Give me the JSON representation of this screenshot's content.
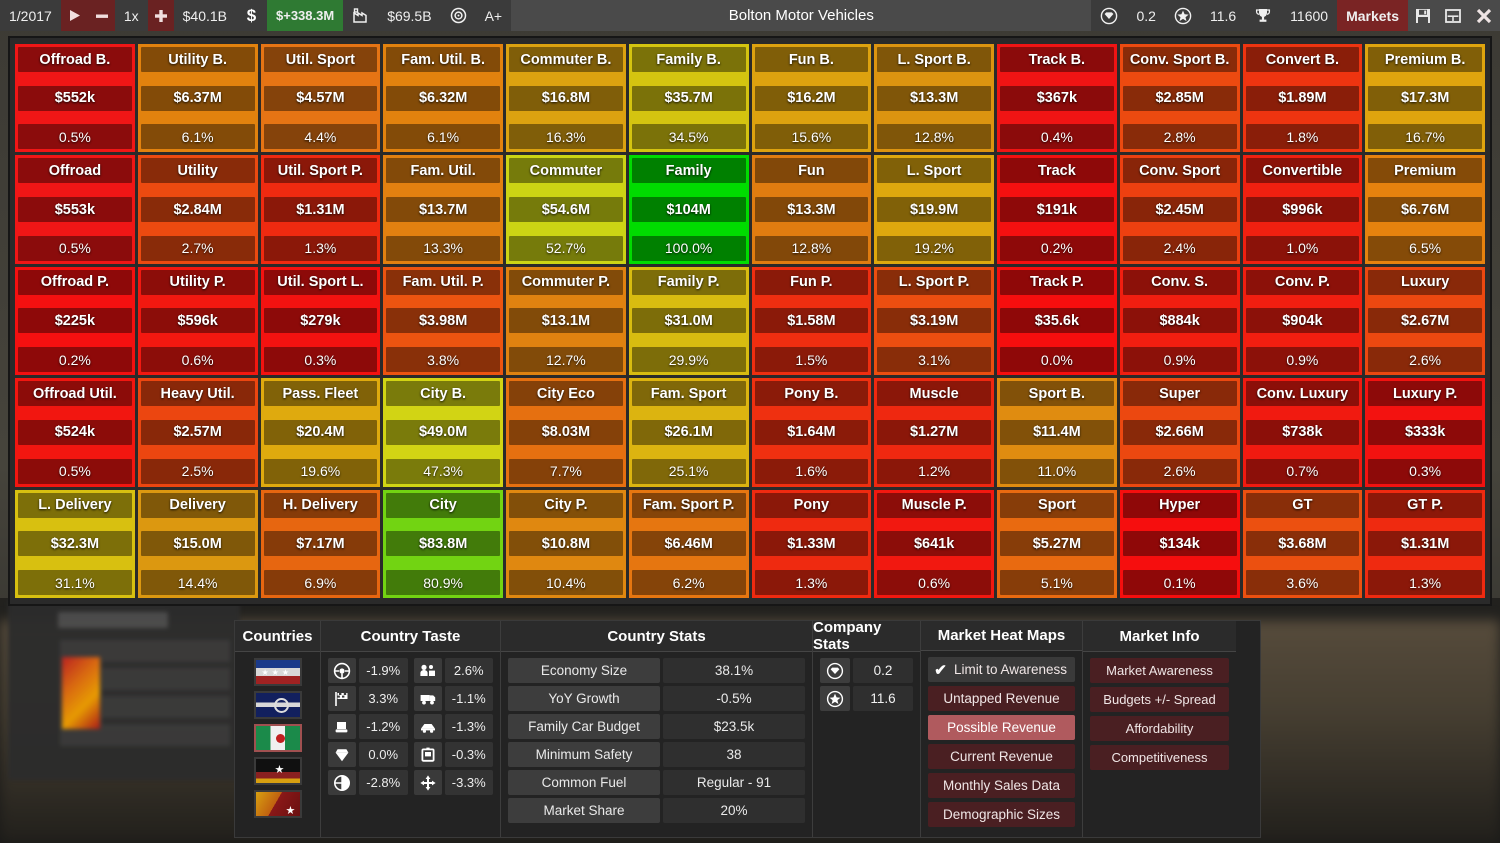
{
  "topbar": {
    "date": "1/2017",
    "play_icon": "play-icon",
    "minus_icon": "minus-icon",
    "speed": "1x",
    "plus_icon": "plus-icon",
    "cash": "$40.1B",
    "dollar_icon": "dollar-icon",
    "profit": "$+338.3M",
    "factory_icon": "factory-icon",
    "assets": "$69.5B",
    "target_icon": "target-icon",
    "rating": "A+",
    "title": "Bolton Motor Vehicles",
    "gem_icon": "gem-icon",
    "gem_value": "0.2",
    "star_icon": "star-icon",
    "star_value": "11.6",
    "trophy_icon": "trophy-icon",
    "trophy_value": "11600",
    "markets_label": "Markets",
    "save_icon": "save-icon",
    "window-icon": "window-icon",
    "close_icon": "close-icon"
  },
  "heatmap": {
    "colors": {
      "lowest": "#e01010",
      "low": "#e64a10",
      "mid": "#e07a10",
      "warm": "#d8a410",
      "yellow": "#d8d010",
      "lime": "#8cd014",
      "green": "#22c422",
      "brightgreen": "#00d800"
    },
    "cells": [
      {
        "name": "Offroad B.",
        "value": "$552k",
        "pct": "0.5%",
        "color": "#f01616"
      },
      {
        "name": "Utility B.",
        "value": "$6.37M",
        "pct": "6.1%",
        "color": "#e2820e"
      },
      {
        "name": "Util. Sport",
        "value": "$4.57M",
        "pct": "4.4%",
        "color": "#e67414"
      },
      {
        "name": "Fam. Util. B.",
        "value": "$6.32M",
        "pct": "6.1%",
        "color": "#e2820e"
      },
      {
        "name": "Commuter B.",
        "value": "$16.8M",
        "pct": "16.3%",
        "color": "#dca210"
      },
      {
        "name": "Family B.",
        "value": "$35.7M",
        "pct": "34.5%",
        "color": "#d4c410"
      },
      {
        "name": "Fun B.",
        "value": "$16.2M",
        "pct": "15.6%",
        "color": "#dda20f"
      },
      {
        "name": "L. Sport B.",
        "value": "$13.3M",
        "pct": "12.8%",
        "color": "#dc9410"
      },
      {
        "name": "Track B.",
        "value": "$367k",
        "pct": "0.4%",
        "color": "#f01414"
      },
      {
        "name": "Conv. Sport B.",
        "value": "$2.85M",
        "pct": "2.8%",
        "color": "#ec4a10"
      },
      {
        "name": "Convert B.",
        "value": "$1.89M",
        "pct": "1.8%",
        "color": "#ee3410"
      },
      {
        "name": "Premium B.",
        "value": "$17.3M",
        "pct": "16.7%",
        "color": "#dfa40e"
      },
      {
        "name": "Offroad",
        "value": "$553k",
        "pct": "0.5%",
        "color": "#f01616"
      },
      {
        "name": "Utility",
        "value": "$2.84M",
        "pct": "2.7%",
        "color": "#ec4a10"
      },
      {
        "name": "Util. Sport P.",
        "value": "$1.31M",
        "pct": "1.3%",
        "color": "#ef2a10"
      },
      {
        "name": "Fam. Util.",
        "value": "$13.7M",
        "pct": "13.3%",
        "color": "#e28010"
      },
      {
        "name": "Commuter",
        "value": "$54.6M",
        "pct": "52.7%",
        "color": "#ccd414"
      },
      {
        "name": "Family",
        "value": "$104M",
        "pct": "100.0%",
        "color": "#00dc00"
      },
      {
        "name": "Fun",
        "value": "$13.3M",
        "pct": "12.8%",
        "color": "#e07c10"
      },
      {
        "name": "L. Sport",
        "value": "$19.9M",
        "pct": "19.2%",
        "color": "#dea80e"
      },
      {
        "name": "Track",
        "value": "$191k",
        "pct": "0.2%",
        "color": "#f41010"
      },
      {
        "name": "Conv. Sport",
        "value": "$2.45M",
        "pct": "2.4%",
        "color": "#ed4010"
      },
      {
        "name": "Convertible",
        "value": "$996k",
        "pct": "1.0%",
        "color": "#f02010"
      },
      {
        "name": "Premium",
        "value": "$6.76M",
        "pct": "6.5%",
        "color": "#e6820e"
      },
      {
        "name": "Offroad P.",
        "value": "$225k",
        "pct": "0.2%",
        "color": "#f41010"
      },
      {
        "name": "Utility P.",
        "value": "$596k",
        "pct": "0.6%",
        "color": "#f21810"
      },
      {
        "name": "Util. Sport L.",
        "value": "$279k",
        "pct": "0.3%",
        "color": "#f31210"
      },
      {
        "name": "Fam. Util. P.",
        "value": "$3.98M",
        "pct": "3.8%",
        "color": "#ec5410"
      },
      {
        "name": "Commuter P.",
        "value": "$13.1M",
        "pct": "12.7%",
        "color": "#e08210"
      },
      {
        "name": "Family P.",
        "value": "$31.0M",
        "pct": "29.9%",
        "color": "#d8bc10"
      },
      {
        "name": "Fun P.",
        "value": "$1.58M",
        "pct": "1.5%",
        "color": "#ef2e10"
      },
      {
        "name": "L. Sport P.",
        "value": "$3.19M",
        "pct": "3.1%",
        "color": "#ec4e10"
      },
      {
        "name": "Track P.",
        "value": "$35.6k",
        "pct": "0.0%",
        "color": "#f60e0e"
      },
      {
        "name": "Conv. S.",
        "value": "$884k",
        "pct": "0.9%",
        "color": "#f11e10"
      },
      {
        "name": "Conv. P.",
        "value": "$904k",
        "pct": "0.9%",
        "color": "#f11e10"
      },
      {
        "name": "Luxury",
        "value": "$2.67M",
        "pct": "2.6%",
        "color": "#ec4810"
      },
      {
        "name": "Offroad Util.",
        "value": "$524k",
        "pct": "0.5%",
        "color": "#f21610"
      },
      {
        "name": "Heavy Util.",
        "value": "$2.57M",
        "pct": "2.5%",
        "color": "#ec4610"
      },
      {
        "name": "Pass. Fleet",
        "value": "$20.4M",
        "pct": "19.6%",
        "color": "#dfaa0e"
      },
      {
        "name": "City B.",
        "value": "$49.0M",
        "pct": "47.3%",
        "color": "#d2d414"
      },
      {
        "name": "City Eco",
        "value": "$8.03M",
        "pct": "7.7%",
        "color": "#e67010"
      },
      {
        "name": "Fam. Sport",
        "value": "$26.1M",
        "pct": "25.1%",
        "color": "#dcb410"
      },
      {
        "name": "Pony B.",
        "value": "$1.64M",
        "pct": "1.6%",
        "color": "#ef3010"
      },
      {
        "name": "Muscle",
        "value": "$1.27M",
        "pct": "1.2%",
        "color": "#ef2810"
      },
      {
        "name": "Sport B.",
        "value": "$11.4M",
        "pct": "11.0%",
        "color": "#e08c10"
      },
      {
        "name": "Super",
        "value": "$2.66M",
        "pct": "2.6%",
        "color": "#ec4810"
      },
      {
        "name": "Conv. Luxury",
        "value": "$738k",
        "pct": "0.7%",
        "color": "#f11a10"
      },
      {
        "name": "Luxury P.",
        "value": "$333k",
        "pct": "0.3%",
        "color": "#f31210"
      },
      {
        "name": "L. Delivery",
        "value": "$32.3M",
        "pct": "31.1%",
        "color": "#d8c010"
      },
      {
        "name": "Delivery",
        "value": "$15.0M",
        "pct": "14.4%",
        "color": "#dc9810"
      },
      {
        "name": "H. Delivery",
        "value": "$7.17M",
        "pct": "6.9%",
        "color": "#e76610"
      },
      {
        "name": "City",
        "value": "$83.8M",
        "pct": "80.9%",
        "color": "#72d412"
      },
      {
        "name": "City P.",
        "value": "$10.8M",
        "pct": "10.4%",
        "color": "#e08810"
      },
      {
        "name": "Fam. Sport P.",
        "value": "$6.46M",
        "pct": "6.2%",
        "color": "#e67610"
      },
      {
        "name": "Pony",
        "value": "$1.33M",
        "pct": "1.3%",
        "color": "#ef2a10"
      },
      {
        "name": "Muscle P.",
        "value": "$641k",
        "pct": "0.6%",
        "color": "#f21810"
      },
      {
        "name": "Sport",
        "value": "$5.27M",
        "pct": "5.1%",
        "color": "#e96a10"
      },
      {
        "name": "Hyper",
        "value": "$134k",
        "pct": "0.1%",
        "color": "#f60e0e"
      },
      {
        "name": "GT",
        "value": "$3.68M",
        "pct": "3.6%",
        "color": "#ec5010"
      },
      {
        "name": "GT P.",
        "value": "$1.31M",
        "pct": "1.3%",
        "color": "#ef2a10"
      }
    ]
  },
  "bottom": {
    "countries": {
      "title": "Countries",
      "flags": [
        {
          "name": "flag-1",
          "selected": false
        },
        {
          "name": "flag-2",
          "selected": false
        },
        {
          "name": "flag-3",
          "selected": true
        },
        {
          "name": "flag-4",
          "selected": false
        },
        {
          "name": "flag-5",
          "selected": false
        }
      ]
    },
    "taste": {
      "title": "Country Taste",
      "left": [
        {
          "icon": "steering-wheel-icon",
          "value": "-1.9%"
        },
        {
          "icon": "checkered-flag-icon",
          "value": "3.3%"
        },
        {
          "icon": "seat-icon",
          "value": "-1.2%"
        },
        {
          "icon": "diamond-icon",
          "value": "0.0%"
        },
        {
          "icon": "wheel-icon",
          "value": "-2.8%"
        }
      ],
      "right": [
        {
          "icon": "people-icon",
          "value": "2.6%"
        },
        {
          "icon": "truck-icon",
          "value": "-1.1%"
        },
        {
          "icon": "cargo-icon",
          "value": "-1.3%"
        },
        {
          "icon": "fuel-can-icon",
          "value": "-0.3%"
        },
        {
          "icon": "move-icon",
          "value": "-3.3%"
        }
      ]
    },
    "country_stats": {
      "title": "Country Stats",
      "rows": [
        {
          "label": "Economy Size",
          "value": "38.1%"
        },
        {
          "label": "YoY Growth",
          "value": "-0.5%"
        },
        {
          "label": "Family Car Budget",
          "value": "$23.5k"
        },
        {
          "label": "Minimum Safety",
          "value": "38"
        },
        {
          "label": "Common Fuel",
          "value": "Regular - 91"
        },
        {
          "label": "Market Share",
          "value": "20%"
        }
      ]
    },
    "company_stats": {
      "title": "Company Stats",
      "rows": [
        {
          "icon": "gem-icon",
          "value": "0.2"
        },
        {
          "icon": "star-icon",
          "value": "11.6"
        }
      ]
    },
    "heat_maps": {
      "title": "Market Heat Maps",
      "checkbox": {
        "label": "Limit to Awareness",
        "checked": true,
        "icon": "check-icon"
      },
      "items": [
        {
          "label": "Untapped Revenue",
          "active": false
        },
        {
          "label": "Possible Revenue",
          "active": true
        },
        {
          "label": "Current Revenue",
          "active": false
        },
        {
          "label": "Monthly Sales Data",
          "active": false
        },
        {
          "label": "Demographic Sizes",
          "active": false
        }
      ]
    },
    "market_info": {
      "title": "Market Info",
      "items": [
        {
          "label": "Market Awareness"
        },
        {
          "label": "Budgets +/- Spread"
        },
        {
          "label": "Affordability"
        },
        {
          "label": "Competitiveness"
        }
      ]
    }
  }
}
